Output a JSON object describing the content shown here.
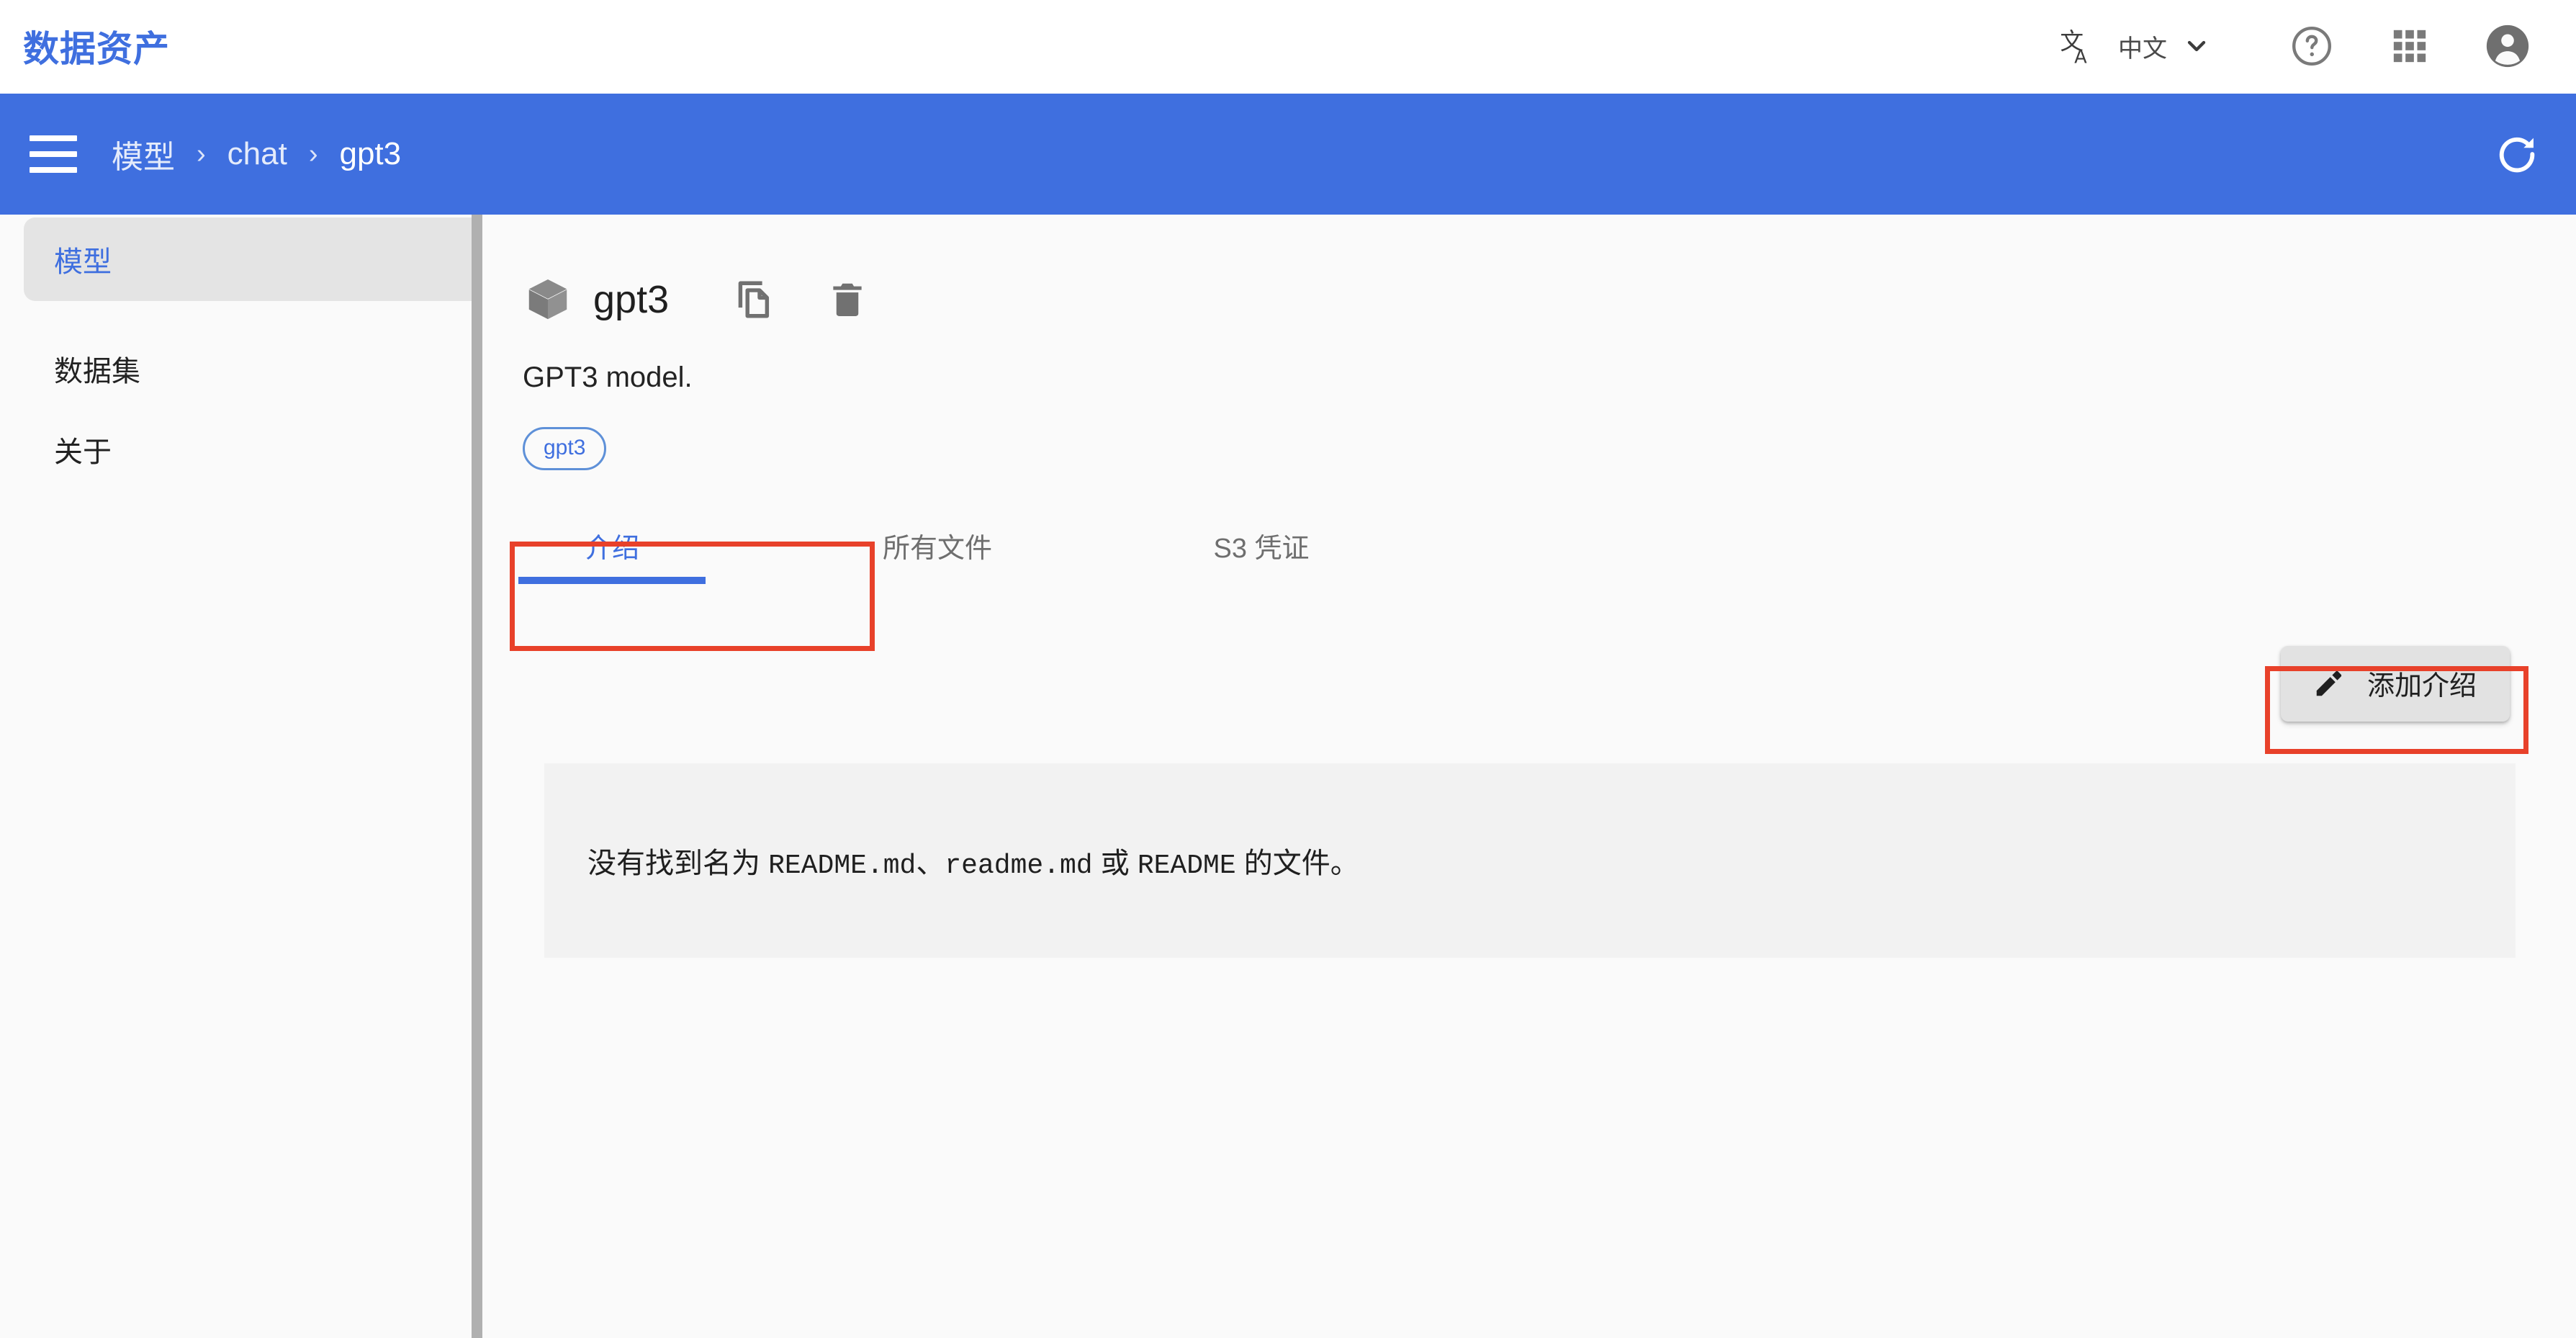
{
  "topbar": {
    "app_title": "数据资产",
    "language": {
      "icon": "translate-icon",
      "label": "中文",
      "chevron": "chevron-down-icon"
    },
    "help_icon": "help-circle-icon",
    "apps_icon": "apps-grid-icon",
    "account_icon": "account-circle-icon"
  },
  "breadcrumb": {
    "menu_icon": "hamburger-menu-icon",
    "items": [
      {
        "label": "模型"
      },
      {
        "label": "chat"
      },
      {
        "label": "gpt3"
      }
    ],
    "separator": "›",
    "refresh_icon": "refresh-icon"
  },
  "sidebar": {
    "items": [
      {
        "label": "模型",
        "active": true
      },
      {
        "label": "数据集",
        "active": false
      },
      {
        "label": "关于",
        "active": false
      }
    ]
  },
  "asset": {
    "type_icon": "cube-icon",
    "name": "gpt3",
    "copy_icon": "copy-icon",
    "delete_icon": "trash-icon",
    "description": "GPT3 model.",
    "tags": [
      "gpt3"
    ]
  },
  "tabs": [
    {
      "label": "介绍",
      "active": true
    },
    {
      "label": "所有文件",
      "active": false
    },
    {
      "label": "S3 凭证",
      "active": false
    }
  ],
  "actions": {
    "add_intro_label": "添加介绍",
    "add_intro_icon": "pencil-edit-icon"
  },
  "readme": {
    "message_prefix": "没有找到名为 ",
    "file_1": "README.md",
    "sep_1": "、",
    "file_2": "readme.md",
    "conjunction": " 或 ",
    "file_3": "README",
    "message_suffix": " 的文件。"
  },
  "colors": {
    "brand_blue": "#3f6fdf",
    "highlight_red": "#e8412a",
    "panel_grey": "#f2f2f2",
    "sidebar_active_bg": "#e4e4e4"
  }
}
